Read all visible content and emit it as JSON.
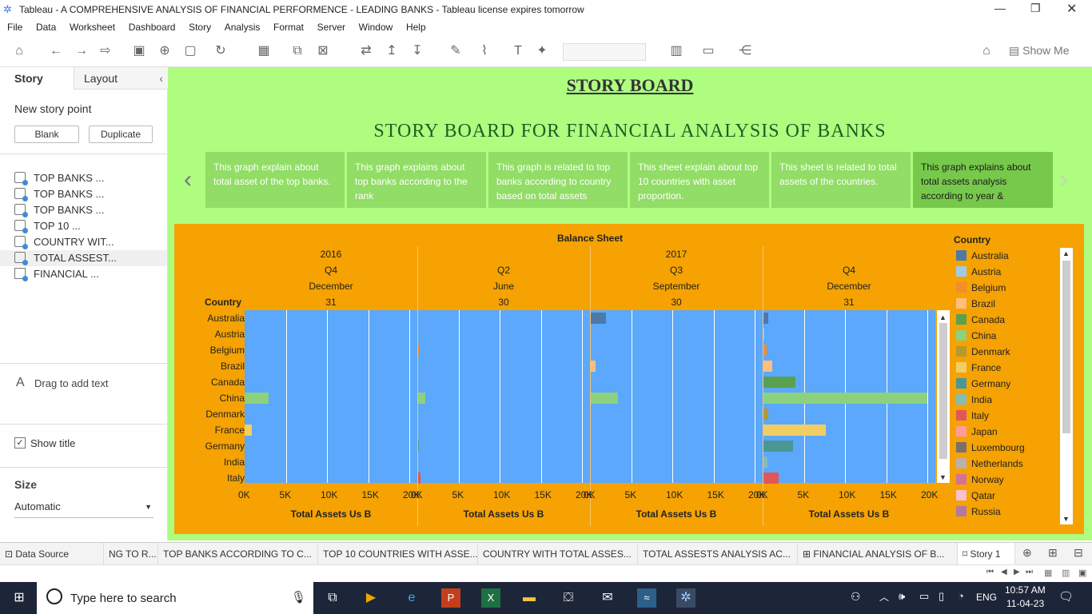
{
  "window": {
    "title": "Tableau - A COMPREHENSIVE ANALYSIS OF FINANCIAL PERFORMENCE - LEADING BANKS - Tableau license expires tomorrow"
  },
  "menu": [
    "File",
    "Data",
    "Worksheet",
    "Dashboard",
    "Story",
    "Analysis",
    "Format",
    "Server",
    "Window",
    "Help"
  ],
  "toolbar": {
    "show_me": "Show Me"
  },
  "sidepanel": {
    "tab_story": "Story",
    "tab_layout": "Layout",
    "new_story_point": "New story point",
    "blank": "Blank",
    "duplicate": "Duplicate",
    "items": [
      "TOP BANKS ...",
      "TOP BANKS ...",
      "TOP BANKS ...",
      "TOP 10 ...",
      "COUNTRY WIT...",
      "TOTAL ASSEST...",
      "FINANCIAL ..."
    ],
    "drag_text": "Drag to add text",
    "show_title": "Show title",
    "size_label": "Size",
    "size_value": "Automatic"
  },
  "story": {
    "title": "STORY BOARD",
    "subtitle": "STORY BOARD FOR FINANCIAL ANALYSIS OF BANKS",
    "captions": [
      "This graph explain about total asset of the top banks.",
      "This graph explains about top banks according to the rank",
      "This graph is related to top banks according to country based on total assets",
      "This sheet explain about top 10 countries with asset proportion.",
      "This sheet is related to total assets of the countries.",
      "This graph explains about total assets analysis according to year &"
    ]
  },
  "chart_data": {
    "type": "bar",
    "title": "Balance Sheet",
    "row_header": "Country",
    "categories": [
      "Australia",
      "Austria",
      "Belgium",
      "Brazil",
      "Canada",
      "China",
      "Denmark",
      "France",
      "Germany",
      "India",
      "Italy"
    ],
    "column_headers": [
      {
        "year": "2016",
        "quarter": "Q4",
        "month": "December",
        "day": "31"
      },
      {
        "year": "",
        "quarter": "Q2",
        "month": "June",
        "day": "30"
      },
      {
        "year": "2017",
        "quarter": "Q3",
        "month": "September",
        "day": "30"
      },
      {
        "year": "",
        "quarter": "Q4",
        "month": "December",
        "day": "31"
      }
    ],
    "xlabel": "Total Assets Us B",
    "xticks": [
      "0K",
      "5K",
      "10K",
      "15K",
      "20K"
    ],
    "xlim": [
      0,
      20000
    ],
    "panels": [
      {
        "Australia": 0,
        "Austria": 0,
        "Belgium": 0,
        "Brazil": 0,
        "Canada": 0,
        "China": 2900,
        "Denmark": 0,
        "France": 900,
        "Germany": 0,
        "India": 0,
        "Italy": 0
      },
      {
        "Australia": 0,
        "Austria": 0,
        "Belgium": 150,
        "Brazil": 0,
        "Canada": 0,
        "China": 1000,
        "Denmark": 0,
        "France": 0,
        "Germany": 150,
        "India": 0,
        "Italy": 350
      },
      {
        "Australia": 1900,
        "Austria": 0,
        "Belgium": 0,
        "Brazil": 650,
        "Canada": 0,
        "China": 3400,
        "Denmark": 0,
        "France": 0,
        "Germany": 0,
        "India": 0,
        "Italy": 0
      },
      {
        "Australia": 650,
        "Austria": 200,
        "Belgium": 450,
        "Brazil": 1200,
        "Canada": 4000,
        "China": 20000,
        "Denmark": 650,
        "France": 7700,
        "Germany": 3700,
        "India": 550,
        "Italy": 1900
      }
    ],
    "legend_title": "Country",
    "legend": [
      {
        "name": "Australia",
        "color": "#4e79a7"
      },
      {
        "name": "Austria",
        "color": "#a0cbe8"
      },
      {
        "name": "Belgium",
        "color": "#f28e2b"
      },
      {
        "name": "Brazil",
        "color": "#ffbe7d"
      },
      {
        "name": "Canada",
        "color": "#59a14f"
      },
      {
        "name": "China",
        "color": "#8cd17d"
      },
      {
        "name": "Denmark",
        "color": "#b6992d"
      },
      {
        "name": "France",
        "color": "#f1ce63"
      },
      {
        "name": "Germany",
        "color": "#499894"
      },
      {
        "name": "India",
        "color": "#86bcb6"
      },
      {
        "name": "Italy",
        "color": "#e15759"
      },
      {
        "name": "Japan",
        "color": "#ff9d9a"
      },
      {
        "name": "Luxembourg",
        "color": "#79706e"
      },
      {
        "name": "Netherlands",
        "color": "#bab0ac"
      },
      {
        "name": "Norway",
        "color": "#d37295"
      },
      {
        "name": "Qatar",
        "color": "#fabfd2"
      },
      {
        "name": "Russia",
        "color": "#b07aa1"
      }
    ]
  },
  "tabs": [
    "Data Source",
    "NG TO R...",
    "TOP BANKS ACCORDING TO C...",
    "TOP 10 COUNTRIES WITH ASSE...",
    "COUNTRY WITH TOTAL ASSES...",
    "TOTAL ASSESTS ANALYSIS AC...",
    "FINANCIAL ANALYSIS OF B...",
    "Story 1"
  ],
  "taskbar": {
    "search": "Type here to search",
    "lang": "ENG",
    "time": "10:57 AM",
    "date": "11-04-23"
  }
}
